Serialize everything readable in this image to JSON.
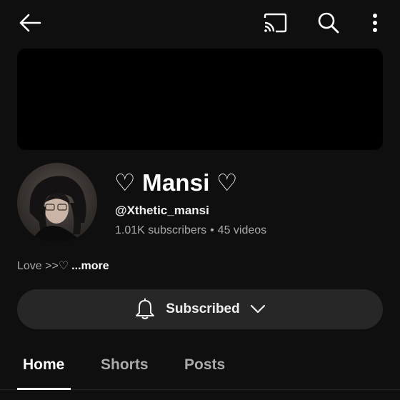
{
  "icons": {
    "back": "arrow-left-icon",
    "cast": "cast-icon",
    "search": "search-icon",
    "more": "more-vert-icon",
    "bell": "bell-icon",
    "chevron": "chevron-down-icon"
  },
  "channel": {
    "name": "♡ Mansi ♡",
    "handle": "@Xthetic_mansi",
    "subscribers": "1.01K subscribers",
    "separator": "•",
    "videos": "45 videos",
    "description": "Love >>♡",
    "more_label": "...more"
  },
  "subscribe_button": {
    "label": "Subscribed"
  },
  "tabs": [
    {
      "label": "Home",
      "active": true
    },
    {
      "label": "Shorts",
      "active": false
    },
    {
      "label": "Posts",
      "active": false
    }
  ],
  "colors": {
    "background": "#0f0f0f",
    "banner": "#000000",
    "button": "#272727",
    "secondary_text": "#aaaaaa"
  }
}
